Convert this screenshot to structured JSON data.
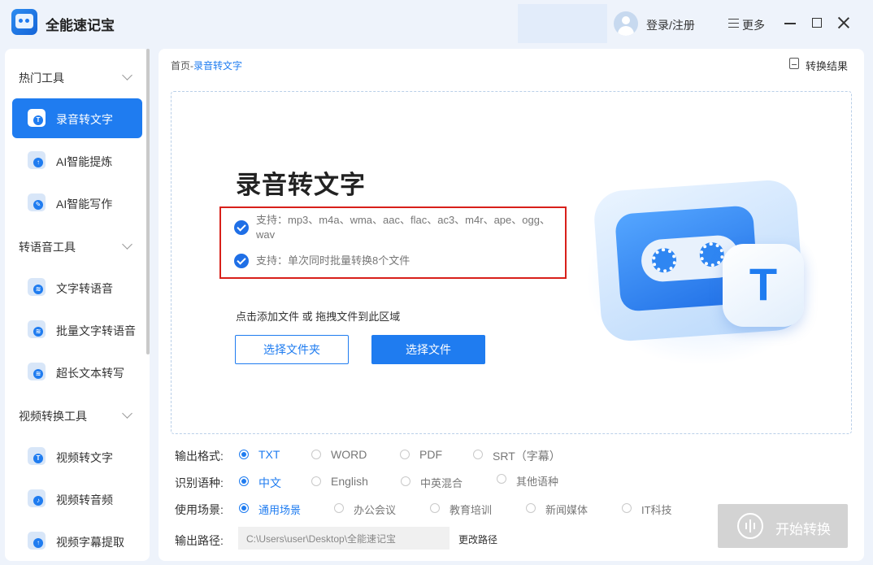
{
  "app": {
    "title": "全能速记宝"
  },
  "header": {
    "login_label": "登录/注册",
    "more_label": "更多"
  },
  "sidebar": {
    "sections": [
      {
        "label": "热门工具",
        "items": [
          {
            "label": "录音转文字",
            "active": true
          },
          {
            "label": "AI智能提炼"
          },
          {
            "label": "AI智能写作"
          }
        ]
      },
      {
        "label": "转语音工具",
        "items": [
          {
            "label": "文字转语音"
          },
          {
            "label": "批量文字转语音"
          },
          {
            "label": "超长文本转写"
          }
        ]
      },
      {
        "label": "视频转换工具",
        "items": [
          {
            "label": "视频转文字"
          },
          {
            "label": "视频转音频"
          },
          {
            "label": "视频字幕提取"
          }
        ]
      }
    ]
  },
  "breadcrumb": {
    "home": "首页",
    "separator": "-",
    "current": "录音转文字"
  },
  "result_link": "转换结果",
  "main": {
    "title": "录音转文字",
    "support_formats": "支持：mp3、m4a、wma、aac、flac、ac3、m4r、ape、ogg、wav",
    "support_batch": "支持：单次同时批量转换8个文件",
    "drop_hint": "点击添加文件 或 拖拽文件到此区域",
    "select_folder_label": "选择文件夹",
    "select_file_label": "选择文件"
  },
  "options": {
    "format": {
      "label": "输出格式:",
      "choices": [
        "TXT",
        "WORD",
        "PDF",
        "SRT（字幕）"
      ],
      "selected": "TXT"
    },
    "language": {
      "label": "识别语种:",
      "choices": [
        "中文",
        "English",
        "中英混合",
        "其他语种"
      ],
      "selected": "中文"
    },
    "scene": {
      "label": "使用场景:",
      "choices": [
        "通用场景",
        "办公会议",
        "教育培训",
        "新闻媒体",
        "IT科技"
      ],
      "selected": "通用场景"
    },
    "path": {
      "label": "输出路径:",
      "value": "C:\\Users\\user\\Desktop\\全能速记宝",
      "change_label": "更改路径"
    }
  },
  "start_button": {
    "label": "开始转换",
    "enabled": false
  },
  "colors": {
    "accent": "#1f7cf0",
    "highlight_border": "#d8201a",
    "disabled_button": "#d3d3d3"
  }
}
